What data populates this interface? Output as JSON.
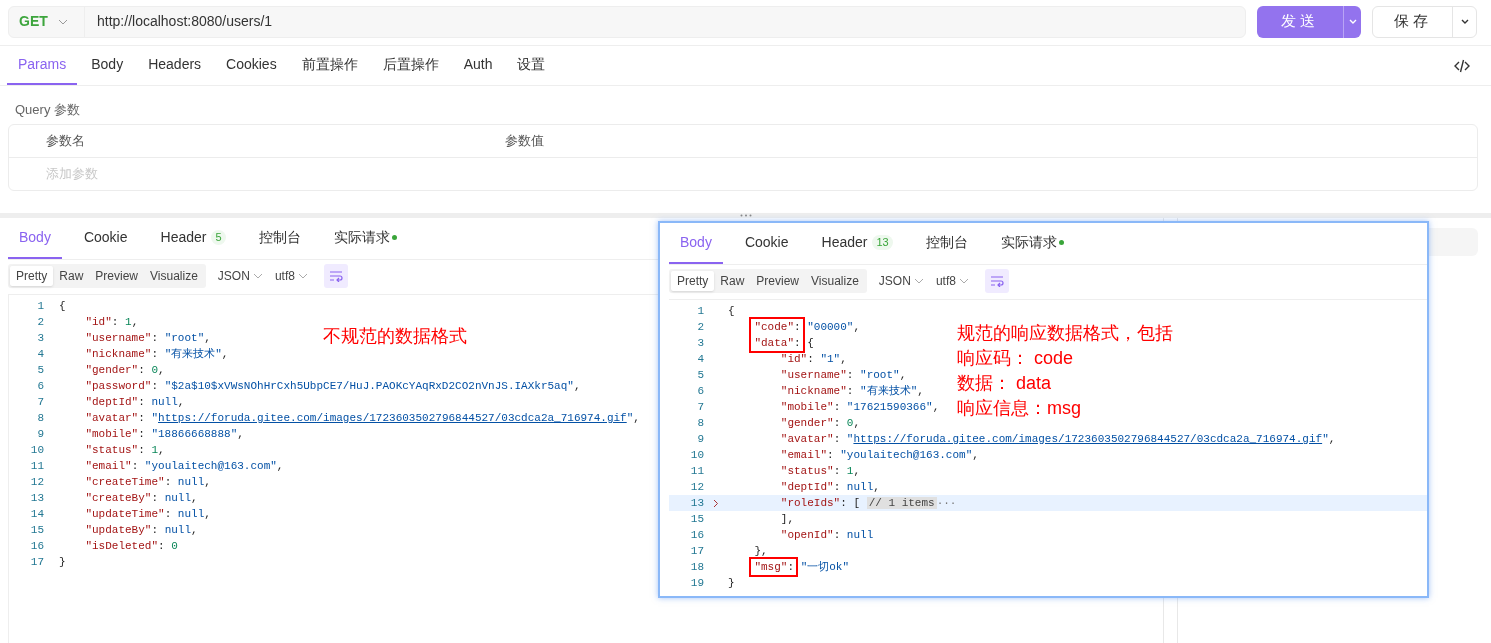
{
  "request": {
    "method": "GET",
    "url": "http://localhost:8080/users/1",
    "send_label": "发送",
    "save_label": "保存"
  },
  "request_tabs": [
    {
      "label": "Params",
      "selected": true
    },
    {
      "label": "Body",
      "selected": false
    },
    {
      "label": "Headers",
      "selected": false
    },
    {
      "label": "Cookies",
      "selected": false
    },
    {
      "label": "前置操作",
      "selected": false
    },
    {
      "label": "后置操作",
      "selected": false
    },
    {
      "label": "Auth",
      "selected": false
    },
    {
      "label": "设置",
      "selected": false
    }
  ],
  "query": {
    "title": "Query 参数",
    "columns": [
      "参数名",
      "参数值"
    ],
    "placeholder": "添加参数"
  },
  "response": {
    "tabs": [
      {
        "label": "Body",
        "selected": true
      },
      {
        "label": "Cookie",
        "selected": false
      },
      {
        "label": "Header",
        "badge": "5",
        "selected": false
      },
      {
        "label": "控制台",
        "selected": false
      },
      {
        "label": "实际请求",
        "dot": true,
        "selected": false
      }
    ],
    "view_modes": [
      {
        "label": "Pretty",
        "selected": true
      },
      {
        "label": "Raw",
        "selected": false
      },
      {
        "label": "Preview",
        "selected": false
      },
      {
        "label": "Visualize",
        "selected": false
      }
    ],
    "format": "JSON",
    "encoding": "utf8",
    "lines": [
      {
        "no": "1",
        "tokens": [
          {
            "kind": "p",
            "text": "{"
          }
        ]
      },
      {
        "no": "2",
        "tokens": [
          {
            "kind": "key",
            "text": "    \"id\""
          },
          {
            "kind": "p",
            "text": ": "
          },
          {
            "kind": "num",
            "text": "1"
          },
          {
            "kind": "p",
            "text": ","
          }
        ]
      },
      {
        "no": "3",
        "tokens": [
          {
            "kind": "key",
            "text": "    \"username\""
          },
          {
            "kind": "p",
            "text": ": "
          },
          {
            "kind": "str",
            "text": "\"root\""
          },
          {
            "kind": "p",
            "text": ","
          }
        ]
      },
      {
        "no": "4",
        "tokens": [
          {
            "kind": "key",
            "text": "    \"nickname\""
          },
          {
            "kind": "p",
            "text": ": "
          },
          {
            "kind": "str",
            "text": "\"有来技术\""
          },
          {
            "kind": "p",
            "text": ","
          }
        ]
      },
      {
        "no": "5",
        "tokens": [
          {
            "kind": "key",
            "text": "    \"gender\""
          },
          {
            "kind": "p",
            "text": ": "
          },
          {
            "kind": "num",
            "text": "0"
          },
          {
            "kind": "p",
            "text": ","
          }
        ]
      },
      {
        "no": "6",
        "tokens": [
          {
            "kind": "key",
            "text": "    \"password\""
          },
          {
            "kind": "p",
            "text": ": "
          },
          {
            "kind": "str",
            "text": "\"$2a$10$xVWsNOhHrCxh5UbpCE7/HuJ.PAOKcYAqRxD2CO2nVnJS.IAXkr5aq\""
          },
          {
            "kind": "p",
            "text": ","
          }
        ]
      },
      {
        "no": "7",
        "tokens": [
          {
            "kind": "key",
            "text": "    \"deptId\""
          },
          {
            "kind": "p",
            "text": ": "
          },
          {
            "kind": "null",
            "text": "null"
          },
          {
            "kind": "p",
            "text": ","
          }
        ]
      },
      {
        "no": "8",
        "tokens": [
          {
            "kind": "key",
            "text": "    \"avatar\""
          },
          {
            "kind": "p",
            "text": ": "
          },
          {
            "kind": "str",
            "text": "\""
          },
          {
            "kind": "url",
            "text": "https://foruda.gitee.com/images/1723603502796844527/03cdca2a_716974.gif"
          },
          {
            "kind": "str",
            "text": "\""
          },
          {
            "kind": "p",
            "text": ","
          }
        ]
      },
      {
        "no": "9",
        "tokens": [
          {
            "kind": "key",
            "text": "    \"mobile\""
          },
          {
            "kind": "p",
            "text": ": "
          },
          {
            "kind": "str",
            "text": "\"18866668888\""
          },
          {
            "kind": "p",
            "text": ","
          }
        ]
      },
      {
        "no": "10",
        "tokens": [
          {
            "kind": "key",
            "text": "    \"status\""
          },
          {
            "kind": "p",
            "text": ": "
          },
          {
            "kind": "num",
            "text": "1"
          },
          {
            "kind": "p",
            "text": ","
          }
        ]
      },
      {
        "no": "11",
        "tokens": [
          {
            "kind": "key",
            "text": "    \"email\""
          },
          {
            "kind": "p",
            "text": ": "
          },
          {
            "kind": "str",
            "text": "\"youlaitech@163.com\""
          },
          {
            "kind": "p",
            "text": ","
          }
        ]
      },
      {
        "no": "12",
        "tokens": [
          {
            "kind": "key",
            "text": "    \"createTime\""
          },
          {
            "kind": "p",
            "text": ": "
          },
          {
            "kind": "null",
            "text": "null"
          },
          {
            "kind": "p",
            "text": ","
          }
        ]
      },
      {
        "no": "13",
        "tokens": [
          {
            "kind": "key",
            "text": "    \"createBy\""
          },
          {
            "kind": "p",
            "text": ": "
          },
          {
            "kind": "null",
            "text": "null"
          },
          {
            "kind": "p",
            "text": ","
          }
        ]
      },
      {
        "no": "14",
        "tokens": [
          {
            "kind": "key",
            "text": "    \"updateTime\""
          },
          {
            "kind": "p",
            "text": ": "
          },
          {
            "kind": "null",
            "text": "null"
          },
          {
            "kind": "p",
            "text": ","
          }
        ]
      },
      {
        "no": "15",
        "tokens": [
          {
            "kind": "key",
            "text": "    \"updateBy\""
          },
          {
            "kind": "p",
            "text": ": "
          },
          {
            "kind": "null",
            "text": "null"
          },
          {
            "kind": "p",
            "text": ","
          }
        ]
      },
      {
        "no": "16",
        "tokens": [
          {
            "kind": "key",
            "text": "    \"isDeleted\""
          },
          {
            "kind": "p",
            "text": ": "
          },
          {
            "kind": "num",
            "text": "0"
          }
        ]
      },
      {
        "no": "17",
        "tokens": [
          {
            "kind": "p",
            "text": "}"
          }
        ]
      }
    ]
  },
  "annotation": "不规范的数据格式",
  "overlay": {
    "tabs": [
      {
        "label": "Body",
        "selected": true
      },
      {
        "label": "Cookie",
        "selected": false
      },
      {
        "label": "Header",
        "badge": "13",
        "selected": false
      },
      {
        "label": "控制台",
        "selected": false
      },
      {
        "label": "实际请求",
        "dot": true,
        "selected": false
      }
    ],
    "view_modes": [
      {
        "label": "Pretty",
        "selected": true
      },
      {
        "label": "Raw",
        "selected": false
      },
      {
        "label": "Preview",
        "selected": false
      },
      {
        "label": "Visualize",
        "selected": false
      }
    ],
    "format": "JSON",
    "encoding": "utf8",
    "lines": [
      {
        "no": "1",
        "marked": false,
        "folded": false,
        "tokens": [
          {
            "kind": "p",
            "text": "{"
          }
        ]
      },
      {
        "no": "2",
        "marked": true,
        "folded": false,
        "tokens": [
          {
            "kind": "key",
            "text": "    \"code\""
          },
          {
            "kind": "p",
            "text": ": "
          },
          {
            "kind": "str",
            "text": "\"00000\""
          },
          {
            "kind": "p",
            "text": ","
          }
        ]
      },
      {
        "no": "3",
        "marked": true,
        "folded": false,
        "tokens": [
          {
            "kind": "key",
            "text": "    \"data\""
          },
          {
            "kind": "p",
            "text": ": {"
          }
        ]
      },
      {
        "no": "4",
        "marked": false,
        "folded": false,
        "tokens": [
          {
            "kind": "key",
            "text": "        \"id\""
          },
          {
            "kind": "p",
            "text": ": "
          },
          {
            "kind": "str",
            "text": "\"1\""
          },
          {
            "kind": "p",
            "text": ","
          }
        ]
      },
      {
        "no": "5",
        "marked": false,
        "folded": false,
        "tokens": [
          {
            "kind": "key",
            "text": "        \"username\""
          },
          {
            "kind": "p",
            "text": ": "
          },
          {
            "kind": "str",
            "text": "\"root\""
          },
          {
            "kind": "p",
            "text": ","
          }
        ]
      },
      {
        "no": "6",
        "marked": false,
        "folded": false,
        "tokens": [
          {
            "kind": "key",
            "text": "        \"nickname\""
          },
          {
            "kind": "p",
            "text": ": "
          },
          {
            "kind": "str",
            "text": "\"有来技术\""
          },
          {
            "kind": "p",
            "text": ","
          }
        ]
      },
      {
        "no": "7",
        "marked": false,
        "folded": false,
        "tokens": [
          {
            "kind": "key",
            "text": "        \"mobile\""
          },
          {
            "kind": "p",
            "text": ": "
          },
          {
            "kind": "str",
            "text": "\"17621590366\""
          },
          {
            "kind": "p",
            "text": ","
          }
        ]
      },
      {
        "no": "8",
        "marked": false,
        "folded": false,
        "tokens": [
          {
            "kind": "key",
            "text": "        \"gender\""
          },
          {
            "kind": "p",
            "text": ": "
          },
          {
            "kind": "num",
            "text": "0"
          },
          {
            "kind": "p",
            "text": ","
          }
        ]
      },
      {
        "no": "9",
        "marked": false,
        "folded": false,
        "tokens": [
          {
            "kind": "key",
            "text": "        \"avatar\""
          },
          {
            "kind": "p",
            "text": ": "
          },
          {
            "kind": "str",
            "text": "\""
          },
          {
            "kind": "url",
            "text": "https://foruda.gitee.com/images/1723603502796844527/03cdca2a_716974.gif"
          },
          {
            "kind": "str",
            "text": "\""
          },
          {
            "kind": "p",
            "text": ","
          }
        ]
      },
      {
        "no": "10",
        "marked": false,
        "folded": false,
        "tokens": [
          {
            "kind": "key",
            "text": "        \"email\""
          },
          {
            "kind": "p",
            "text": ": "
          },
          {
            "kind": "str",
            "text": "\"youlaitech@163.com\""
          },
          {
            "kind": "p",
            "text": ","
          }
        ]
      },
      {
        "no": "11",
        "marked": false,
        "folded": false,
        "tokens": [
          {
            "kind": "key",
            "text": "        \"status\""
          },
          {
            "kind": "p",
            "text": ": "
          },
          {
            "kind": "num",
            "text": "1"
          },
          {
            "kind": "p",
            "text": ","
          }
        ]
      },
      {
        "no": "12",
        "marked": false,
        "folded": false,
        "tokens": [
          {
            "kind": "key",
            "text": "        \"deptId\""
          },
          {
            "kind": "p",
            "text": ": "
          },
          {
            "kind": "null",
            "text": "null"
          },
          {
            "kind": "p",
            "text": ","
          }
        ]
      },
      {
        "no": "13",
        "marked": false,
        "folded": true,
        "tokens": [
          {
            "kind": "key",
            "text": "        \"roleIds\""
          },
          {
            "kind": "p",
            "text": ": [ "
          },
          {
            "kind": "fold",
            "text": "// 1 items"
          },
          {
            "kind": "more",
            "text": "···"
          }
        ]
      },
      {
        "no": "15",
        "marked": false,
        "folded": false,
        "tokens": [
          {
            "kind": "p",
            "text": "        ],"
          }
        ]
      },
      {
        "no": "16",
        "marked": false,
        "folded": false,
        "tokens": [
          {
            "kind": "key",
            "text": "        \"openId\""
          },
          {
            "kind": "p",
            "text": ": "
          },
          {
            "kind": "null",
            "text": "null"
          }
        ]
      },
      {
        "no": "17",
        "marked": false,
        "folded": false,
        "tokens": [
          {
            "kind": "p",
            "text": "    },"
          }
        ]
      },
      {
        "no": "18",
        "marked": true,
        "folded": false,
        "tokens": [
          {
            "kind": "key",
            "text": "    \"msg\""
          },
          {
            "kind": "p",
            "text": ": "
          },
          {
            "kind": "str",
            "text": "\"一切ok\""
          }
        ]
      },
      {
        "no": "19",
        "marked": false,
        "folded": false,
        "tokens": [
          {
            "kind": "p",
            "text": "}"
          }
        ]
      }
    ]
  },
  "annotation_lines": [
    "规范的响应数据格式，包括",
    "响应码： code",
    "数据： data",
    "响应信息：msg"
  ]
}
